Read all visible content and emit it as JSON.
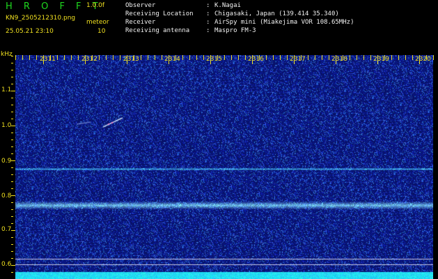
{
  "header": {
    "title": "H R O F F T",
    "version": "1.0.0f",
    "filename": "KN9_2505212310.png",
    "type_label": "meteor",
    "datetime": "25.05.21 23:10",
    "count": "10",
    "info": [
      {
        "key": "Observer",
        "value": "K.Nagai"
      },
      {
        "key": "Receiving Location",
        "value": "Chigasaki, Japan (139.414 35.340)"
      },
      {
        "key": "Receiver",
        "value": "AirSpy mini (Miakejima VOR 108.65MHz)"
      },
      {
        "key": "Receiving antenna",
        "value": "Maspro FM-3"
      }
    ]
  },
  "y_axis": {
    "unit": "kHz",
    "ticks": [
      "1.1",
      "1.0",
      "0.9",
      "0.8",
      "0.7",
      "0.6"
    ]
  },
  "x_axis": {
    "ticks": [
      "2311",
      "2312",
      "2313",
      "2314",
      "2315",
      "2316",
      "2317",
      "2318",
      "2319",
      "2320"
    ]
  },
  "colors": {
    "background": "#000000",
    "plot_background": "#0b1577",
    "label_yellow": "#f0e020",
    "title_green": "#1fd81f",
    "signal": "#8fd0ff",
    "baseline": "#18e8ff"
  }
}
